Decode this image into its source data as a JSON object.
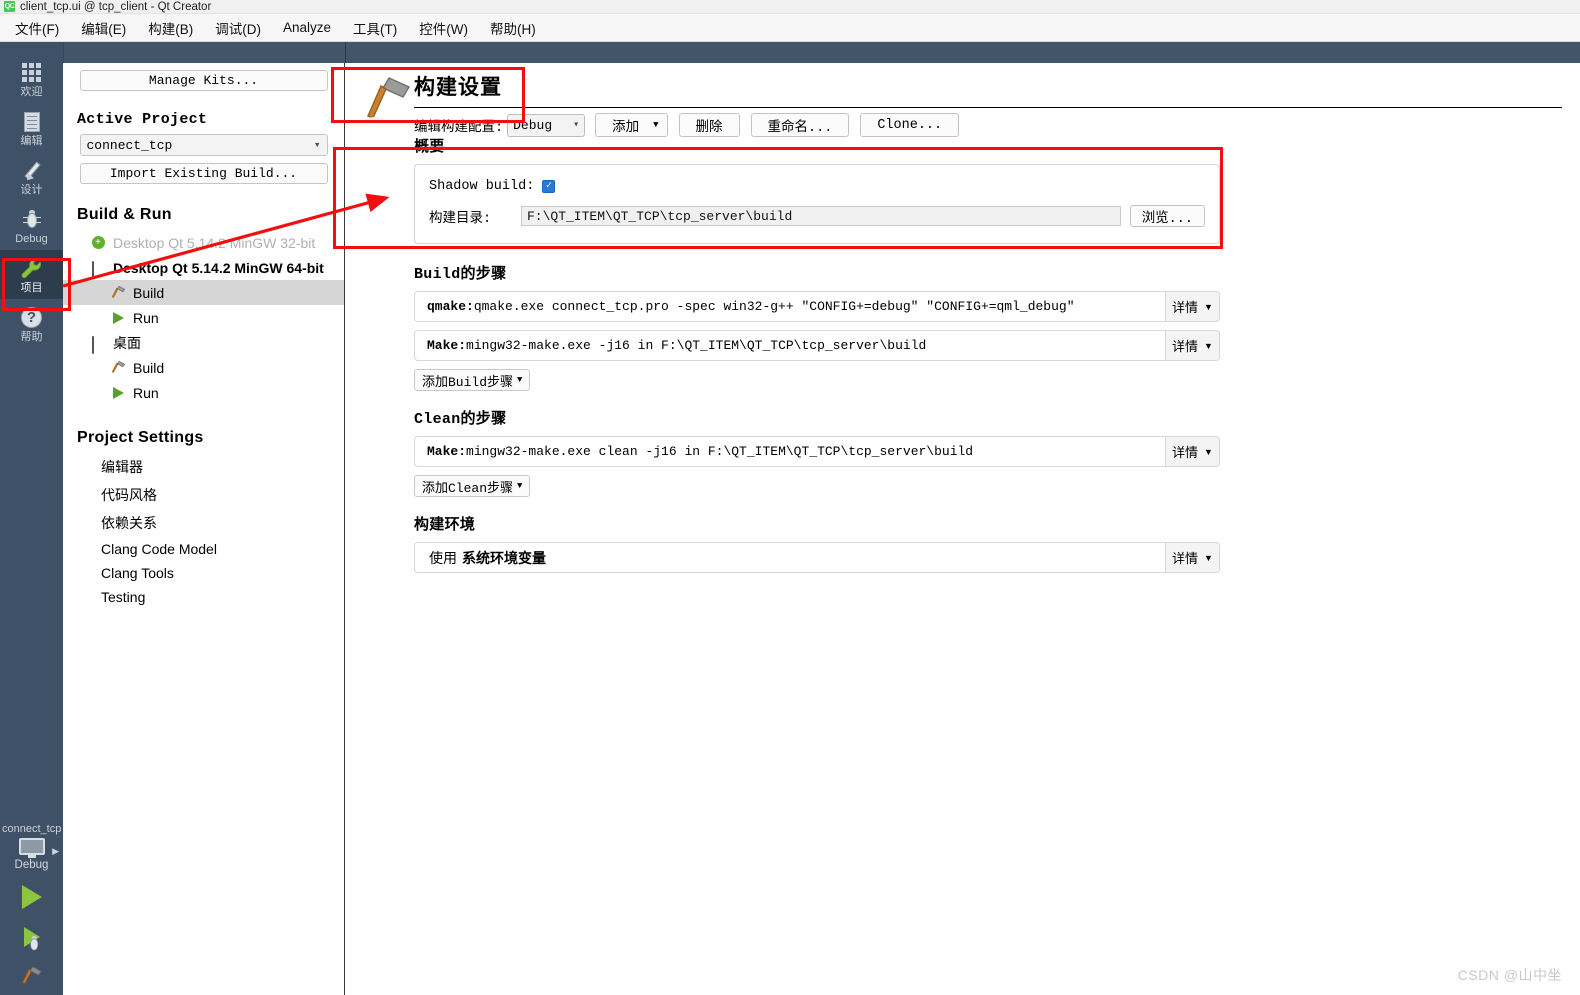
{
  "window": {
    "title": "client_tcp.ui @ tcp_client - Qt Creator",
    "logo_text": "QC"
  },
  "menubar": {
    "items": [
      {
        "label": "文件(F)",
        "name": "menu-file"
      },
      {
        "label": "编辑(E)",
        "name": "menu-edit"
      },
      {
        "label": "构建(B)",
        "name": "menu-build"
      },
      {
        "label": "调试(D)",
        "name": "menu-debug"
      },
      {
        "label": "Analyze",
        "name": "menu-analyze"
      },
      {
        "label": "工具(T)",
        "name": "menu-tools"
      },
      {
        "label": "控件(W)",
        "name": "menu-window"
      },
      {
        "label": "帮助(H)",
        "name": "menu-help"
      }
    ]
  },
  "modebar": {
    "items": [
      {
        "label": "欢迎",
        "icon": "grid-icon",
        "selected": false
      },
      {
        "label": "编辑",
        "icon": "document-icon",
        "selected": false
      },
      {
        "label": "设计",
        "icon": "pencil-icon",
        "selected": false
      },
      {
        "label": "Debug",
        "icon": "bug-icon",
        "selected": false
      },
      {
        "label": "项目",
        "icon": "wrench-icon",
        "selected": true
      },
      {
        "label": "帮助",
        "icon": "question-circle-icon",
        "selected": false
      }
    ],
    "project_name": "connect_tcp",
    "kit_label": "Debug",
    "run_label": "Run",
    "debug_label": "Start Debugging",
    "build_label": "Build"
  },
  "left_panel": {
    "manage_kits": "Manage Kits...",
    "active_project_title": "Active Project",
    "active_project_value": "connect_tcp",
    "import_existing_build": "Import Existing Build...",
    "build_run_title": "Build & Run",
    "tree": [
      {
        "label": "Desktop Qt 5.14.2 MinGW 32-bit",
        "type": "kit-inactive",
        "icon": "plus-badge-icon",
        "selected": false
      },
      {
        "label": "Desktop Qt 5.14.2 MinGW 64-bit",
        "type": "kit-active",
        "icon": "monitor-icon",
        "selected": false
      },
      {
        "label": "Build",
        "type": "child",
        "icon": "hammer-icon",
        "selected": true
      },
      {
        "label": "Run",
        "type": "child",
        "icon": "play-icon",
        "selected": false
      },
      {
        "label": "桌面",
        "type": "kit-active",
        "icon": "monitor-icon",
        "selected": false
      },
      {
        "label": "Build",
        "type": "child",
        "icon": "hammer-icon",
        "selected": false
      },
      {
        "label": "Run",
        "type": "child",
        "icon": "play-icon",
        "selected": false
      }
    ],
    "project_settings_title": "Project Settings",
    "settings_items": [
      {
        "label": "编辑器"
      },
      {
        "label": "代码风格"
      },
      {
        "label": "依赖关系"
      },
      {
        "label": "Clang Code Model"
      },
      {
        "label": "Clang Tools"
      },
      {
        "label": "Testing"
      }
    ]
  },
  "build_settings": {
    "title": "构建设置",
    "config_label": "编辑构建配置:",
    "config_value": "Debug",
    "add_button": "添加",
    "delete_button": "删除",
    "rename_button": "重命名...",
    "clone_button": "Clone...",
    "summary": {
      "title": "概要",
      "shadow_build_label": "Shadow build:",
      "shadow_build_checked": "✓",
      "build_dir_label": "构建目录:",
      "build_dir_value": "F:\\QT_ITEM\\QT_TCP\\tcp_server\\build",
      "browse_button": "浏览..."
    },
    "build_steps": {
      "title": "Build的步骤",
      "steps": [
        {
          "kind": "qmake:",
          "text": " qmake.exe connect_tcp.pro -spec win32-g++ \"CONFIG+=debug\" \"CONFIG+=qml_debug\"",
          "details": "详情"
        },
        {
          "kind": "Make:",
          "text": " mingw32-make.exe -j16 in F:\\QT_ITEM\\QT_TCP\\tcp_server\\build",
          "details": "详情"
        }
      ],
      "add_label": "添加Build步骤"
    },
    "clean_steps": {
      "title": "Clean的步骤",
      "steps": [
        {
          "kind": "Make:",
          "text": " mingw32-make.exe clean -j16 in F:\\QT_ITEM\\QT_TCP\\tcp_server\\build",
          "details": "详情"
        }
      ],
      "add_label": "添加Clean步骤"
    },
    "build_env": {
      "title": "构建环境",
      "use_label": "使用",
      "value_label": "系统环境变量",
      "details": "详情"
    }
  },
  "watermark": "CSDN @山中坐",
  "colors": {
    "accent_red": "#f30f0f",
    "sidebar": "#3f5166",
    "sidebar_selected": "#2e3d4d",
    "checkbox_blue": "#2979d8",
    "green": "#8cc63f"
  }
}
